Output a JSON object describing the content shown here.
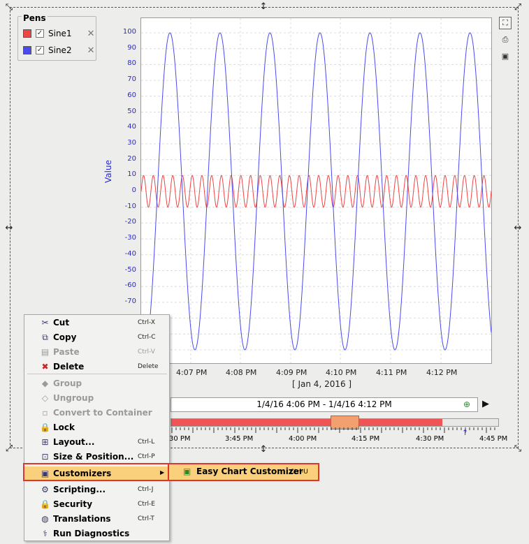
{
  "pens": {
    "title": "Pens",
    "items": [
      {
        "name": "Sine1",
        "color": "#ee4444"
      },
      {
        "name": "Sine2",
        "color": "#4a4aee"
      }
    ]
  },
  "chart_data": {
    "type": "line",
    "title": "",
    "ylabel": "Value",
    "ylim": [
      -100,
      100
    ],
    "y_ticks": [
      "100",
      "90",
      "80",
      "70",
      "60",
      "50",
      "40",
      "30",
      "20",
      "10",
      "0",
      "-10",
      "-20",
      "-30",
      "-40",
      "-50",
      "-60",
      "-70"
    ],
    "x_ticks": [
      "4:07 PM",
      "4:08 PM",
      "4:09 PM",
      "4:10 PM",
      "4:11 PM",
      "4:12 PM"
    ],
    "xlabel": "[ Jan 4, 2016 ]",
    "grid": true,
    "series": [
      {
        "name": "Sine1",
        "color": "#ee4444",
        "amplitude": 10,
        "cycles": 36
      },
      {
        "name": "Sine2",
        "color": "#4a4aee",
        "amplitude": 100,
        "cycles": 7
      }
    ]
  },
  "range": {
    "label": "1/4/16 4:06 PM - 1/4/16 4:12 PM",
    "timeline_ticks": [
      "30 PM",
      "3:45 PM",
      "4:00 PM",
      "4:15 PM",
      "4:30 PM",
      "4:45 PM"
    ]
  },
  "menu": {
    "items": [
      {
        "label": "Cut",
        "shortcut": "Ctrl-X",
        "icon": "scissors-icon",
        "glyph": "✂",
        "enabled": true
      },
      {
        "label": "Copy",
        "shortcut": "Ctrl-C",
        "icon": "copy-icon",
        "glyph": "⧉",
        "enabled": true
      },
      {
        "label": "Paste",
        "shortcut": "Ctrl-V",
        "icon": "paste-icon",
        "glyph": "▤",
        "enabled": false
      },
      {
        "label": "Delete",
        "shortcut": "Delete",
        "icon": "delete-icon",
        "glyph": "✖",
        "enabled": true
      },
      {
        "label": "Group",
        "shortcut": "",
        "icon": "group-icon",
        "glyph": "◆",
        "enabled": false
      },
      {
        "label": "Ungroup",
        "shortcut": "",
        "icon": "ungroup-icon",
        "glyph": "◇",
        "enabled": false
      },
      {
        "label": "Convert to Container",
        "shortcut": "",
        "icon": "convert-icon",
        "glyph": "▫",
        "enabled": false
      },
      {
        "label": "Lock",
        "shortcut": "",
        "icon": "lock-icon",
        "glyph": "🔒",
        "enabled": true
      },
      {
        "label": "Layout...",
        "shortcut": "Ctrl-L",
        "icon": "layout-icon",
        "glyph": "⊞",
        "enabled": true
      },
      {
        "label": "Size & Position...",
        "shortcut": "Ctrl-P",
        "icon": "size-position-icon",
        "glyph": "⊡",
        "enabled": true
      },
      {
        "label": "Customizers",
        "shortcut": "",
        "icon": "customizers-icon",
        "glyph": "▣",
        "enabled": true,
        "highlighted": true
      },
      {
        "label": "Scripting...",
        "shortcut": "Ctrl-J",
        "icon": "scripting-icon",
        "glyph": "⚙",
        "enabled": true
      },
      {
        "label": "Security",
        "shortcut": "Ctrl-E",
        "icon": "security-icon",
        "glyph": "🔒",
        "enabled": true
      },
      {
        "label": "Translations",
        "shortcut": "Ctrl-T",
        "icon": "globe-icon",
        "glyph": "◍",
        "enabled": true
      },
      {
        "label": "Run Diagnostics",
        "shortcut": "",
        "icon": "diagnostics-icon",
        "glyph": "⚕",
        "enabled": true
      }
    ]
  },
  "submenu": {
    "label": "Easy Chart Customizer",
    "shortcut": "Ctrl-U",
    "icon": "customizers-icon"
  },
  "colors": {
    "accent_highlight": "#fbd07c",
    "outline_red": "#e0342e",
    "axis_blue": "#2a2ad0",
    "timeline_red": "#f05555",
    "timeline_thumb": "#f2a070"
  }
}
